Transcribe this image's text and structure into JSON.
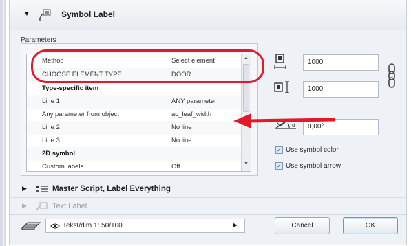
{
  "header": {
    "title": "Symbol Label"
  },
  "parameters": {
    "label": "Parameters",
    "rows": [
      {
        "name": "Method",
        "value": "Select element",
        "section": false
      },
      {
        "name": "CHOOSE ELEMENT TYPE",
        "value": "DOOR",
        "section": false
      },
      {
        "name": "Type-specific item",
        "value": "",
        "section": true
      },
      {
        "name": "Line 1",
        "value": "ANY parameter",
        "section": false
      },
      {
        "name": "Any parameter from object",
        "value": "ac_leaf_width",
        "section": false
      },
      {
        "name": "Line 2",
        "value": "No line",
        "section": false
      },
      {
        "name": "Line 3",
        "value": "No line",
        "section": false
      },
      {
        "name": "2D symbol",
        "value": "",
        "section": true
      },
      {
        "name": "Custom labels",
        "value": "Off",
        "section": false
      }
    ]
  },
  "fields": {
    "width": "1000",
    "height": "1000",
    "angle": "0,00°"
  },
  "checkboxes": [
    {
      "label": "Use symbol color",
      "checked": true
    },
    {
      "label": "Use symbol arrow",
      "checked": true
    }
  ],
  "sections": [
    {
      "title": "Master Script, Label Everything"
    },
    {
      "title": "Text Label"
    }
  ],
  "footer": {
    "layer": "Tekst/dim 1: 50/100",
    "cancel": "Cancel",
    "ok": "OK"
  },
  "colors": {
    "annotation_red": "#e3192b",
    "panel": "#eef1f5"
  }
}
